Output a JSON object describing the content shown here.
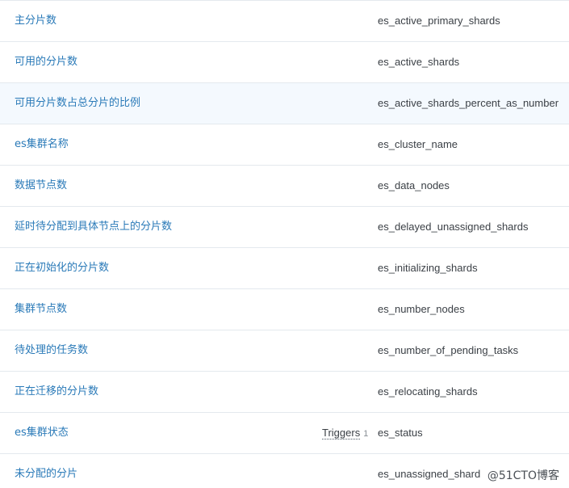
{
  "items": [
    {
      "name": "主分片数",
      "key": "es_active_primary_shards"
    },
    {
      "name": "可用的分片数",
      "key": "es_active_shards"
    },
    {
      "name": "可用分片数占总分片的比例",
      "key": "es_active_shards_percent_as_number"
    },
    {
      "name": "es集群名称",
      "key": "es_cluster_name"
    },
    {
      "name": "数据节点数",
      "key": "es_data_nodes"
    },
    {
      "name": "延时待分配到具体节点上的分片数",
      "key": "es_delayed_unassigned_shards"
    },
    {
      "name": "正在初始化的分片数",
      "key": "es_initializing_shards"
    },
    {
      "name": "集群节点数",
      "key": "es_number_nodes"
    },
    {
      "name": "待处理的任务数",
      "key": "es_number_of_pending_tasks"
    },
    {
      "name": "正在迁移的分片数",
      "key": "es_relocating_shards"
    },
    {
      "name": "es集群状态",
      "key": "es_status",
      "triggers_label": "Triggers",
      "triggers_count": "1"
    },
    {
      "name": "未分配的分片",
      "key": "es_unassigned_shard"
    }
  ],
  "watermark": "@51CTO博客",
  "colors": {
    "link": "#2a7ab8",
    "text": "#3b4046",
    "border": "#e4e9ee",
    "highlight_row": "#f4f9fe"
  }
}
